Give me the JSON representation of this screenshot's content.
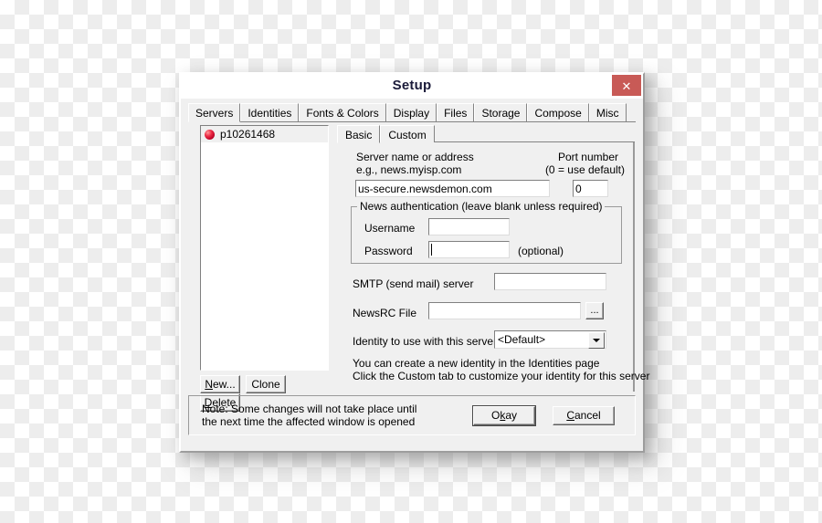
{
  "window": {
    "title": "Setup",
    "close_label": "✕",
    "close_color": "#c85a56"
  },
  "tabs": [
    {
      "label": "Servers",
      "active": true
    },
    {
      "label": "Identities",
      "active": false
    },
    {
      "label": "Fonts & Colors",
      "active": false
    },
    {
      "label": "Display",
      "active": false
    },
    {
      "label": "Files",
      "active": false
    },
    {
      "label": "Storage",
      "active": false
    },
    {
      "label": "Compose",
      "active": false
    },
    {
      "label": "Misc",
      "active": false
    }
  ],
  "server_list": {
    "items": [
      {
        "label": "p10261468",
        "icon": "red-sphere-icon",
        "selected": true
      }
    ],
    "buttons": {
      "new": "New...",
      "new_mnemonic": "N",
      "clone": "Clone",
      "delete": "Delete",
      "delete_mnemonic": "D"
    }
  },
  "settings": {
    "subtabs": [
      {
        "label": "Basic",
        "active": true
      },
      {
        "label": "Custom",
        "active": false
      }
    ],
    "server_address": {
      "label_line1": "Server name or address",
      "label_line2": "e.g., news.myisp.com",
      "value": "us-secure.newsdemon.com",
      "placeholder": ""
    },
    "port": {
      "label_line1": "Port number",
      "label_line2": "(0 = use default)",
      "value": "0",
      "placeholder": ""
    },
    "news_auth": {
      "group_title": "News authentication (leave blank unless required)",
      "username_label": "Username",
      "username_value": "",
      "password_label": "Password",
      "password_value": "",
      "optional_label": "(optional)"
    },
    "smtp": {
      "label": "SMTP (send mail) server",
      "value": ""
    },
    "newsrc": {
      "label": "NewsRC File",
      "value": "",
      "browse_label": "..."
    },
    "identity": {
      "label": "Identity to use with this server",
      "selected": "<Default>",
      "options": [
        "<Default>"
      ]
    },
    "help_line1": "You can create a new identity in the Identities page",
    "help_line2": "Click the Custom tab to customize your identity for this server"
  },
  "footer": {
    "note_line1": "Note: Some changes will not take place until",
    "note_line2": "the next time the affected window is opened",
    "okay_label": "Okay",
    "okay_mnemonic": "k",
    "cancel_label": "Cancel",
    "cancel_mnemonic": "C"
  }
}
